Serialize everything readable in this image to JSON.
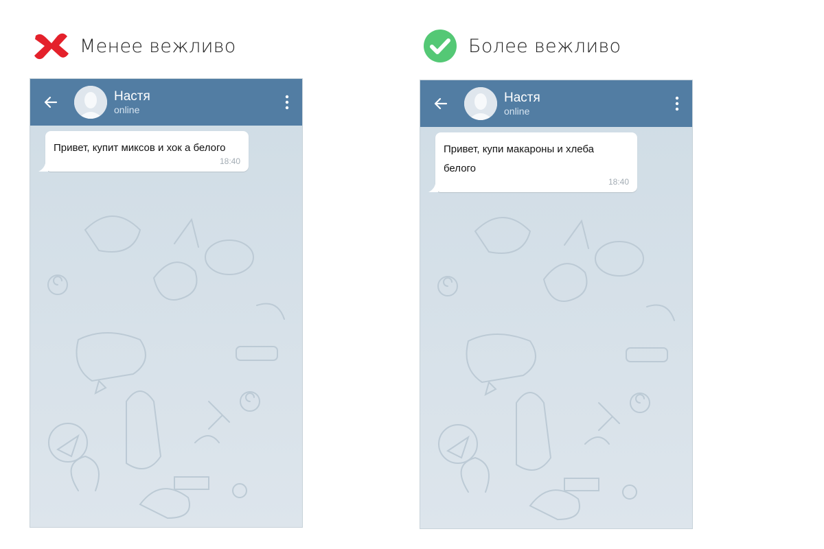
{
  "comparison": [
    {
      "caption": "Менее вежливо",
      "verdict_icon": "red-cross-icon",
      "verdict_color": "#e4212b",
      "chat": {
        "contact_name": "Настя",
        "contact_status": "online",
        "message": "Привет, купит миксов и хок а белого",
        "time": "18:40"
      }
    },
    {
      "caption": "Более вежливо",
      "verdict_icon": "green-check-icon",
      "verdict_color": "#54c875",
      "chat": {
        "contact_name": "Настя",
        "contact_status": "online",
        "message": "Привет, купи макароны и хлеба белого",
        "time": "18:40"
      }
    }
  ],
  "colors": {
    "header": "#527da3",
    "chat_background": "#d3dfe6",
    "bubble": "#ffffff"
  }
}
